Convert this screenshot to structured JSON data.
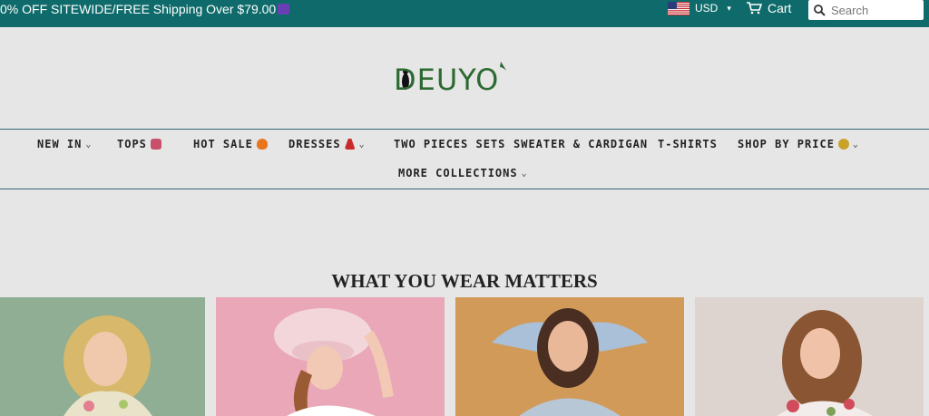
{
  "topbar": {
    "promo_text": "0% OFF SITEWIDE/FREE Shipping Over $79.00",
    "currency": "USD",
    "cart_label": "Cart",
    "search_placeholder": "Search"
  },
  "logo": {
    "text": "DEUYO"
  },
  "nav": {
    "items": [
      {
        "label": "NEW IN"
      },
      {
        "label": "TOPS"
      },
      {
        "label": "HOT SALE"
      },
      {
        "label": "DRESSES"
      },
      {
        "label": "TWO PIECES SETS"
      },
      {
        "label": "SWEATER & CARDIGAN"
      },
      {
        "label": "T-SHIRTS"
      },
      {
        "label": "SHOP BY PRICE"
      },
      {
        "label": "MORE COLLECTIONS"
      }
    ]
  },
  "section": {
    "heading": "WHAT YOU WEAR MATTERS"
  },
  "colors": {
    "topbar_bg": "#0f6b6b",
    "page_bg": "#e6e6e6",
    "nav_rule": "#33677a",
    "logo_green": "#2d6a32"
  }
}
